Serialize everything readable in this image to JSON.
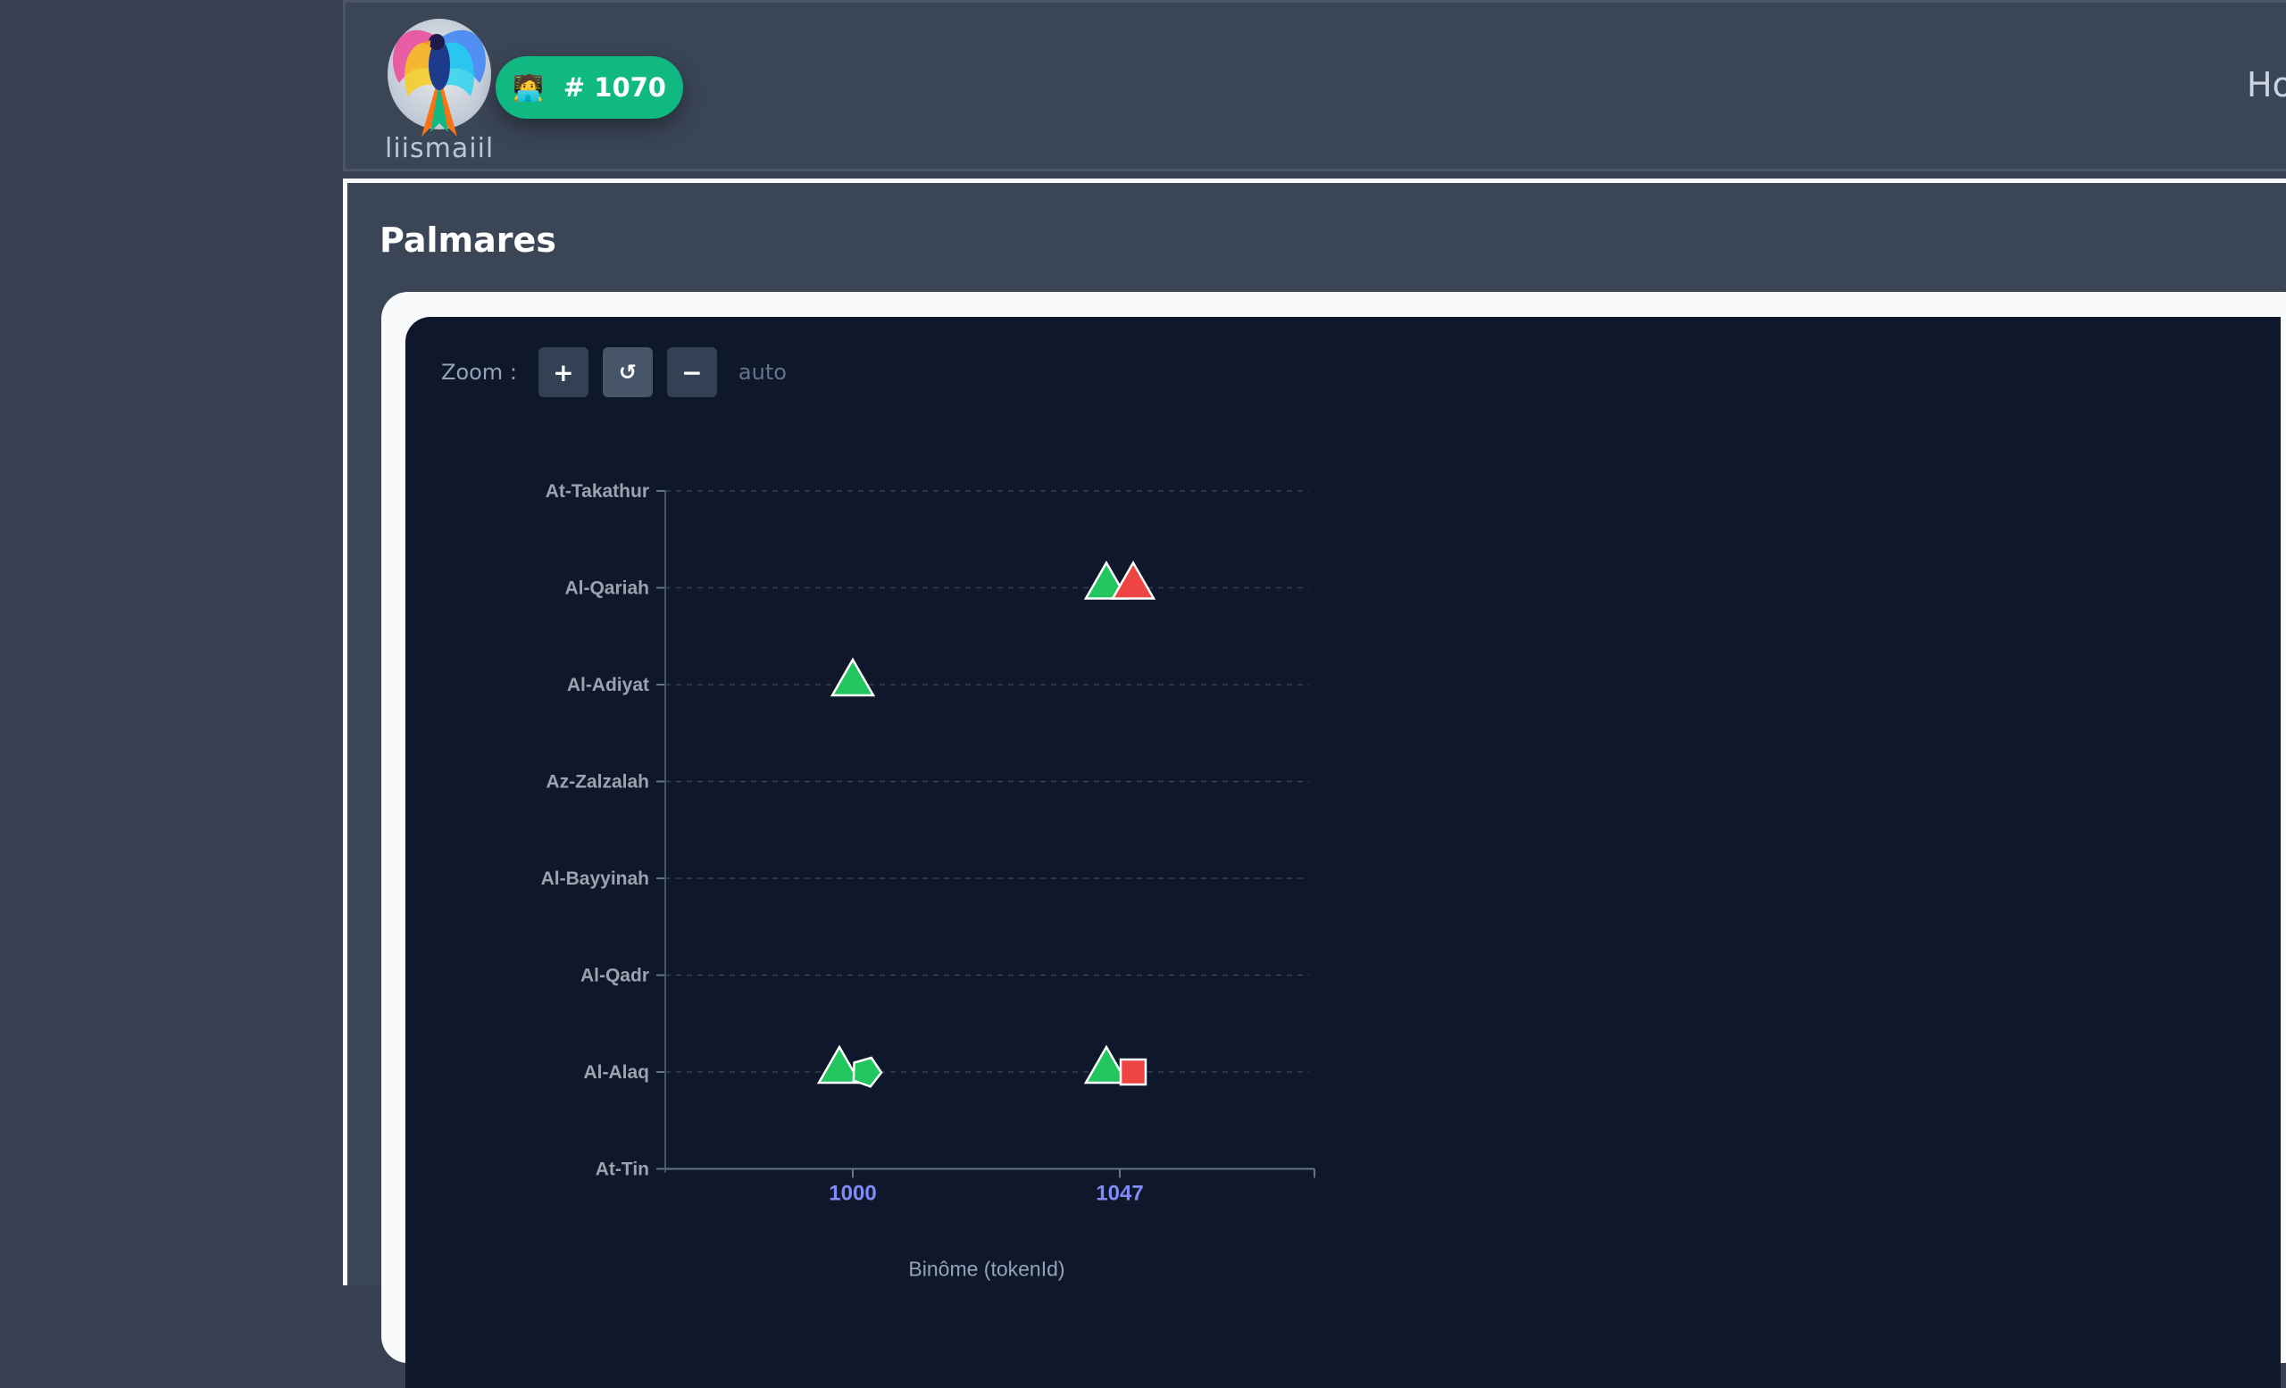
{
  "header": {
    "logo_text": "liismaiil",
    "badge_emoji": "🧑‍💻",
    "badge_label": "# 1070",
    "nav_home": "Ho"
  },
  "page": {
    "title": "Palmares"
  },
  "zoom": {
    "label": "Zoom :",
    "zoom_in_label": "+",
    "reset_label": "↺",
    "zoom_out_label": "−",
    "mode": "auto"
  },
  "chart_data": {
    "type": "scatter",
    "xlabel": "Binôme (tokenId)",
    "ylabel": "",
    "x_ticks": [
      1000,
      1047
    ],
    "y_categories": [
      "At-Takathur",
      "Al-Qariah",
      "Al-Adiyat",
      "Az-Zalzalah",
      "Al-Bayyinah",
      "Al-Qadr",
      "Al-Alaq",
      "At-Tin"
    ],
    "grid": "horizontal dashed",
    "points": [
      {
        "x": 1047,
        "y": "Al-Qariah",
        "shape": "triangle",
        "color": "#22c55e",
        "offset": -1
      },
      {
        "x": 1047,
        "y": "Al-Qariah",
        "shape": "triangle",
        "color": "#ef4444",
        "offset": 1
      },
      {
        "x": 1000,
        "y": "Al-Adiyat",
        "shape": "triangle",
        "color": "#22c55e",
        "offset": 0
      },
      {
        "x": 1000,
        "y": "Al-Alaq",
        "shape": "triangle",
        "color": "#22c55e",
        "offset": -1
      },
      {
        "x": 1000,
        "y": "Al-Alaq",
        "shape": "pentagon",
        "color": "#22c55e",
        "offset": 1
      },
      {
        "x": 1047,
        "y": "Al-Alaq",
        "shape": "triangle",
        "color": "#22c55e",
        "offset": -1
      },
      {
        "x": 1047,
        "y": "Al-Alaq",
        "shape": "square",
        "color": "#ef4444",
        "offset": 1
      }
    ],
    "colors": {
      "axis_tick_label": "#818cf8",
      "category_label": "#9ca3af",
      "grid": "#334155"
    }
  }
}
